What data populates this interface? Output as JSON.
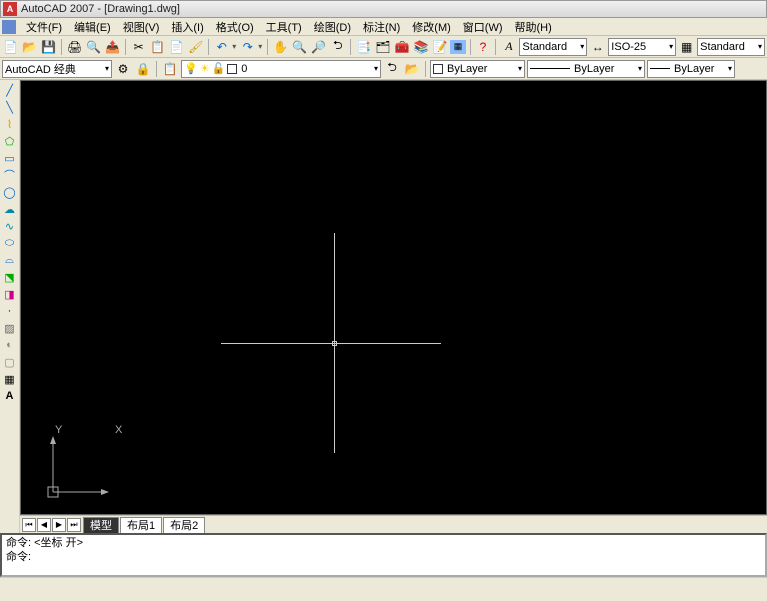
{
  "title": "AutoCAD 2007 - [Drawing1.dwg]",
  "menu": {
    "file": "文件(F)",
    "edit": "编辑(E)",
    "view": "视图(V)",
    "insert": "插入(I)",
    "format": "格式(O)",
    "tools": "工具(T)",
    "draw": "绘图(D)",
    "dim": "标注(N)",
    "modify": "修改(M)",
    "window": "窗口(W)",
    "help": "帮助(H)"
  },
  "toolbar1": {
    "text_style": "Standard",
    "dim_style": "ISO-25",
    "table_style": "Standard"
  },
  "toolbar2": {
    "workspace": "AutoCAD 经典",
    "layer": "0",
    "color": "ByLayer",
    "linetype": "ByLayer",
    "lineweight": "ByLayer"
  },
  "ucs": {
    "x": "X",
    "y": "Y"
  },
  "tabs": {
    "model": "模型",
    "layout1": "布局1",
    "layout2": "布局2"
  },
  "cmd": {
    "line1_label": "命令:",
    "line1_text": "<坐标 开>",
    "line2_label": "命令:"
  }
}
